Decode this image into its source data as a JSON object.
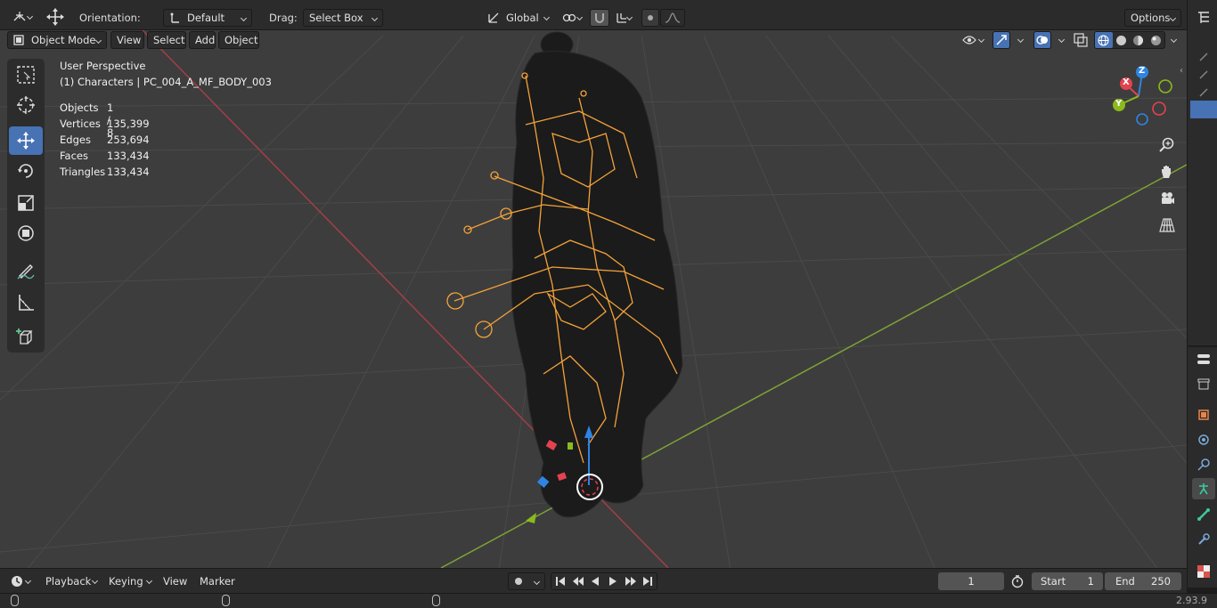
{
  "header": {
    "orientation_label": "Orientation:",
    "orientation_value": "Default",
    "drag_label": "Drag:",
    "drag_value": "Select Box",
    "transform_space": "Global",
    "options_label": "Options"
  },
  "viewport_header": {
    "mode": "Object Mode",
    "menus": [
      "View",
      "Select",
      "Add",
      "Object"
    ]
  },
  "overlay": {
    "perspective": "User Perspective",
    "collection_object": "(1) Characters | PC_004_A_MF_BODY_003",
    "stats": [
      {
        "label": "Objects",
        "value": "1 / 8"
      },
      {
        "label": "Vertices",
        "value": "135,399"
      },
      {
        "label": "Edges",
        "value": "253,694"
      },
      {
        "label": "Faces",
        "value": "133,434"
      },
      {
        "label": "Triangles",
        "value": "133,434"
      }
    ]
  },
  "gizmo": {
    "axes": [
      "X",
      "Y",
      "Z"
    ],
    "colors": {
      "x": "#e2434f",
      "y": "#8bba1d",
      "z": "#2f84e3"
    }
  },
  "timeline": {
    "menus": [
      "Playback",
      "Keying",
      "View",
      "Marker"
    ],
    "current_frame": "1",
    "start_label": "Start",
    "start_value": "1",
    "end_label": "End",
    "end_value": "250"
  },
  "status": {
    "version": "2.93.9"
  },
  "colors": {
    "viewport_bg": "#3d3d3d",
    "armature": "#f4a23a",
    "active_tool": "#4772b3",
    "x_axis_line": "#a33e48",
    "y_axis_line": "#7ea236"
  }
}
